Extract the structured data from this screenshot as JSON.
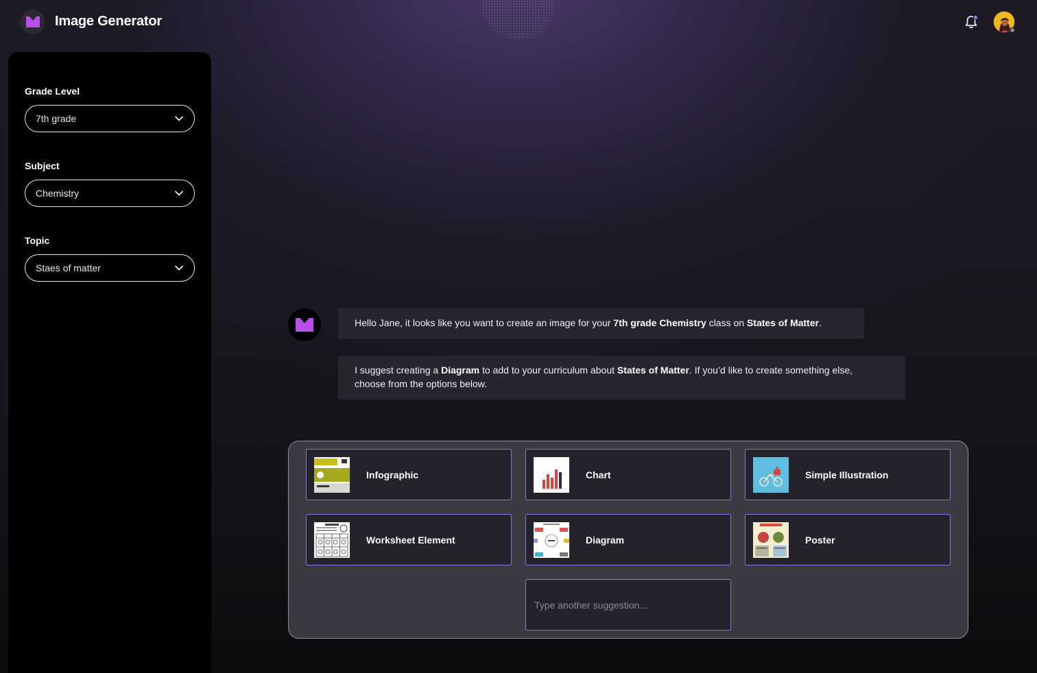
{
  "header": {
    "app_title": "Image Generator",
    "logo_icon": "brand-m-icon",
    "notification_icon": "bell-icon",
    "accent_color": "#b84fe8"
  },
  "sidebar": {
    "fields": [
      {
        "label": "Grade Level",
        "value": "7th grade"
      },
      {
        "label": "Subject",
        "value": "Chemistry"
      },
      {
        "label": "Topic",
        "value": "Staes of matter"
      }
    ]
  },
  "chat": {
    "message1": {
      "p1": "Hello Jane, it looks like you want to create an image for your ",
      "b1": "7th grade Chemistry",
      "p2": " class on ",
      "b2": "States of Matter",
      "p3": "."
    },
    "message2": {
      "p1": "I suggest creating a ",
      "b1": "Diagram",
      "p2": " to add to your curriculum about ",
      "b2": "States of Matter",
      "p3": ". If you’d like to create something else,",
      "p4": "choose from the options below."
    }
  },
  "options": {
    "items": [
      {
        "label": "Infographic"
      },
      {
        "label": "Chart"
      },
      {
        "label": "Simple Illustration"
      },
      {
        "label": "Worksheet Element"
      },
      {
        "label": "Diagram"
      },
      {
        "label": "Poster"
      }
    ],
    "suggestion_placeholder": "Type another suggestion..."
  }
}
